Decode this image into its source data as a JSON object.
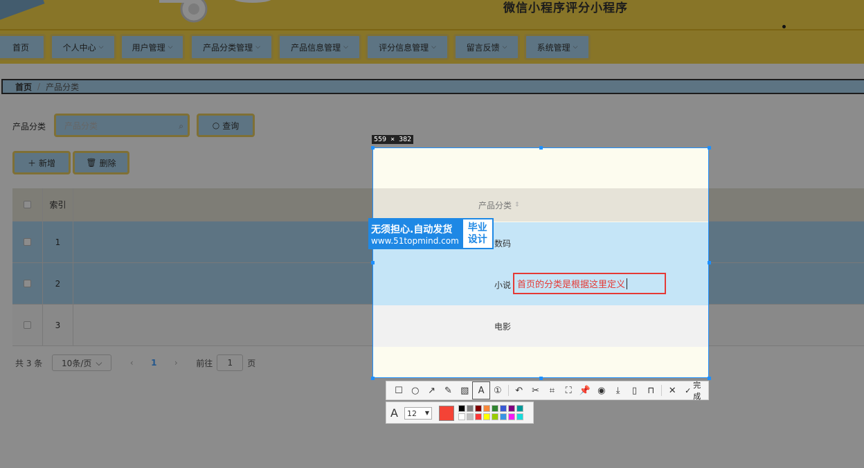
{
  "header": {
    "site_title": "微信小程序评分小程序"
  },
  "nav": {
    "items": [
      {
        "label": "首页",
        "has_dropdown": false
      },
      {
        "label": "个人中心",
        "has_dropdown": true
      },
      {
        "label": "用户管理",
        "has_dropdown": true
      },
      {
        "label": "产品分类管理",
        "has_dropdown": true
      },
      {
        "label": "产品信息管理",
        "has_dropdown": true
      },
      {
        "label": "评分信息管理",
        "has_dropdown": true
      },
      {
        "label": "留言反馈",
        "has_dropdown": true
      },
      {
        "label": "系统管理",
        "has_dropdown": true
      }
    ]
  },
  "breadcrumb": {
    "home": "首页",
    "separator": "/",
    "current": "产品分类"
  },
  "filter": {
    "label": "产品分类",
    "placeholder": "产品分类",
    "search_label": "查询"
  },
  "actions": {
    "add_label": "新增",
    "delete_label": "删除"
  },
  "table": {
    "header_index": "索引",
    "header_category": "产品分类",
    "rows": [
      {
        "index": "1",
        "category": "数码"
      },
      {
        "index": "2",
        "category": "小说"
      },
      {
        "index": "3",
        "category": "电影"
      }
    ]
  },
  "pagination": {
    "total": "共 3 条",
    "page_size": "10条/页",
    "current_page": "1",
    "goto_label": "前往",
    "goto_value": "1",
    "page_suffix": "页"
  },
  "capture": {
    "size_label": "559 × 382",
    "annotation_text": "首页的分类是根据这里定义",
    "done_label": "完成",
    "font_size": "12",
    "current_color": "#f44336",
    "palette": [
      "#000000",
      "#808080",
      "#800000",
      "#f7883a",
      "#308430",
      "#385ad3",
      "#800080",
      "#009999",
      "#ffffff",
      "#c0c0c0",
      "#fb3838",
      "#ffff00",
      "#99cc00",
      "#3894e4",
      "#f31bf3",
      "#16dcdc"
    ]
  },
  "watermark": {
    "line1": "无须担心.自动发货",
    "line2": "www.51topmind.com",
    "badge_line1": "毕业",
    "badge_line2": "设计"
  },
  "colors": {
    "header_yellow": "#f8d64a",
    "button_blue": "#a9d4ee",
    "button_border": "#e8cc61",
    "selection_blue": "#1e90ff",
    "annotation_red": "#e53935"
  }
}
